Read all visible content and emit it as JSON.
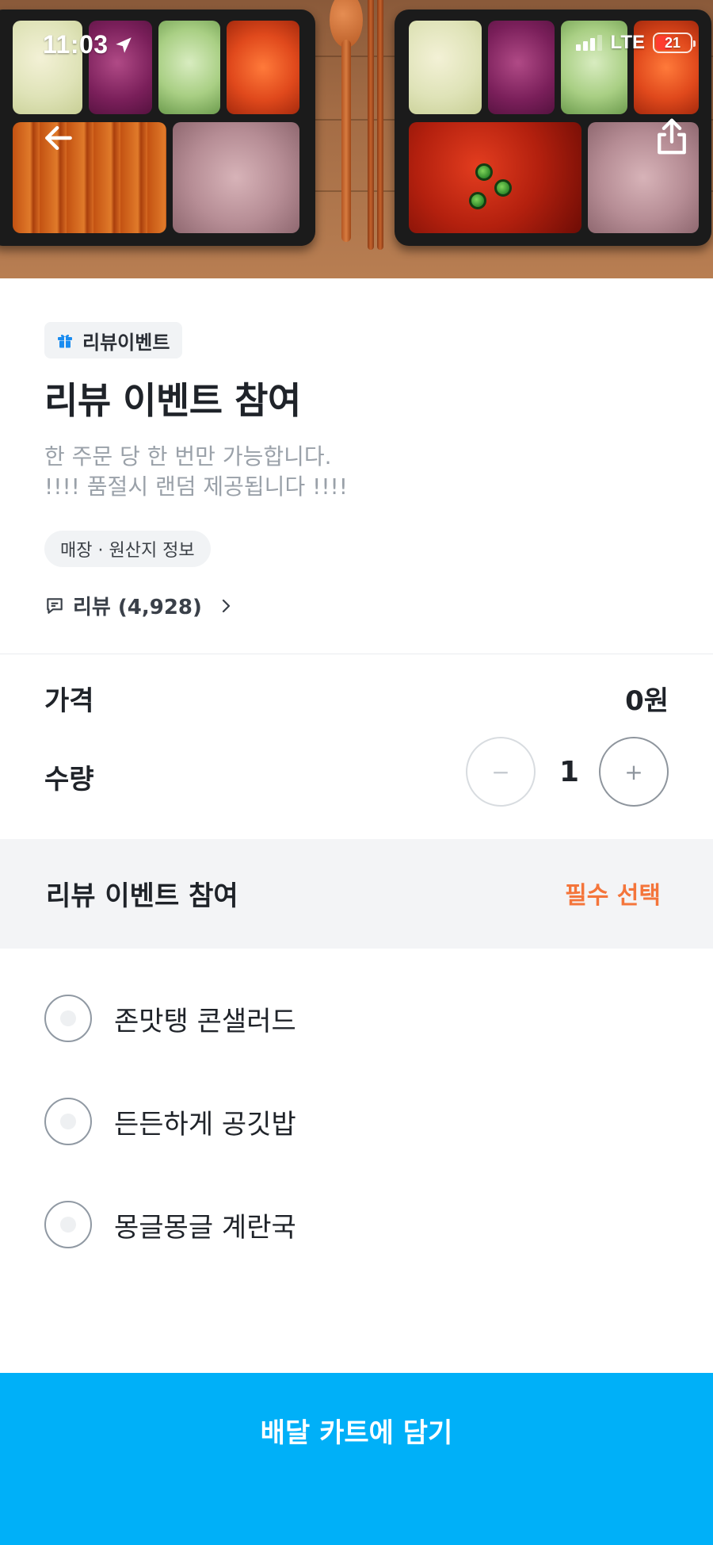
{
  "status_bar": {
    "time": "11:03",
    "network": "LTE",
    "battery": "21"
  },
  "hero": {
    "image_alt": "food-photo-two-lunchboxes"
  },
  "product": {
    "badge": "리뷰이벤트",
    "title": "리뷰 이벤트 참여",
    "description_line1": "한 주문 당 한 번만 가능합니다.",
    "description_line2": "!!!! 품절시 랜덤 제공됩니다 !!!!",
    "origin_chip": "매장 · 원산지 정보",
    "review_label": "리뷰 (4,928)"
  },
  "price": {
    "label": "가격",
    "value": "0원"
  },
  "quantity": {
    "label": "수량",
    "value": "1",
    "minus": "−",
    "plus": "+"
  },
  "option_group": {
    "title": "리뷰 이벤트 참여",
    "required_label": "필수 선택",
    "options": [
      {
        "label": "존맛탱 콘샐러드"
      },
      {
        "label": "든든하게 공깃밥"
      },
      {
        "label": "몽글몽글 계란국"
      }
    ]
  },
  "cta": {
    "label": "배달 카트에 담기"
  },
  "colors": {
    "accent": "#00b0f8",
    "required": "#f4753b"
  }
}
